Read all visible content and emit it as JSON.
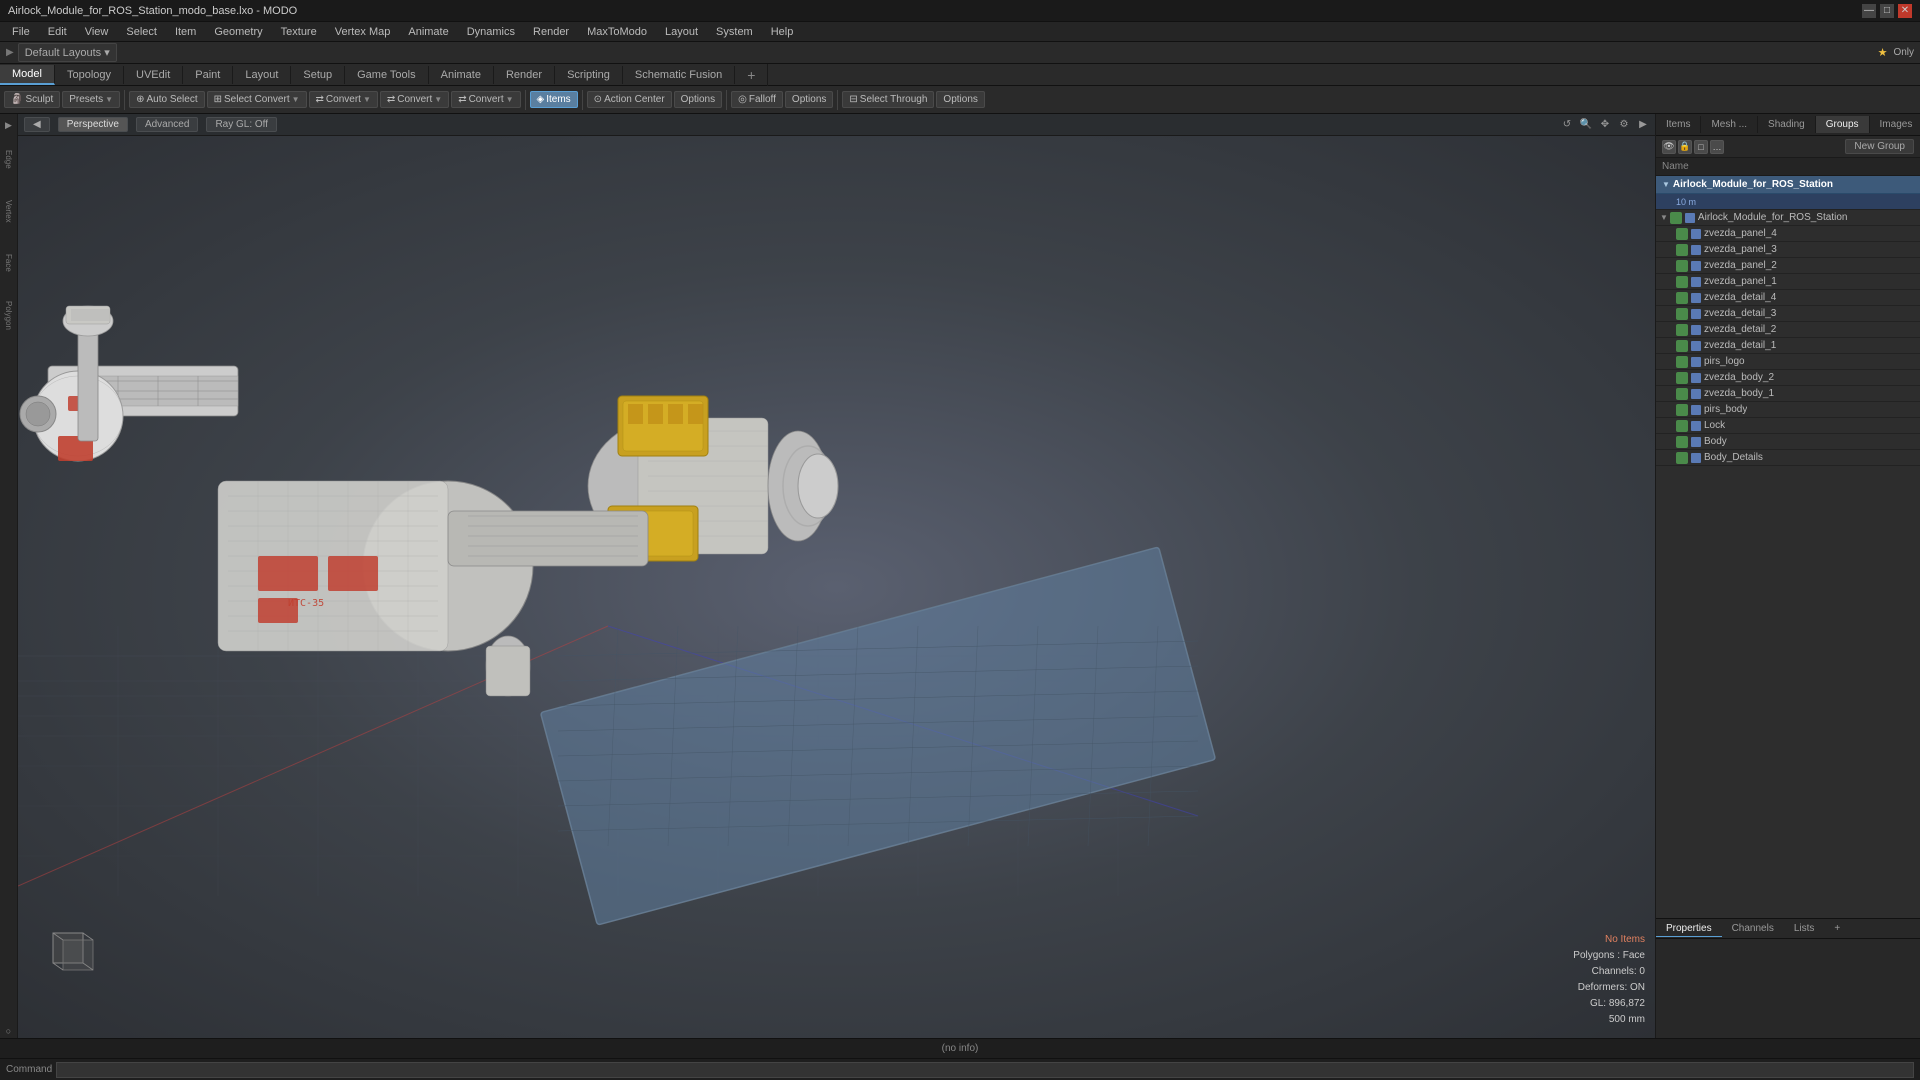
{
  "titleBar": {
    "title": "Airlock_Module_for_ROS_Station_modo_base.lxo - MODO",
    "winBtns": [
      "—",
      "□",
      "✕"
    ]
  },
  "menuBar": {
    "items": [
      "File",
      "Edit",
      "View",
      "Select",
      "Item",
      "Geometry",
      "Texture",
      "Vertex Map",
      "Animate",
      "Dynamics",
      "Render",
      "MaxToModo",
      "Layout",
      "System",
      "Help"
    ]
  },
  "layoutBar": {
    "layoutLabel": "Default Layouts",
    "rightIcons": [
      "★",
      "Only"
    ]
  },
  "modeTabs": {
    "tabs": [
      "Model",
      "Topology",
      "UVEdit",
      "Paint",
      "Layout",
      "Setup",
      "Game Tools",
      "Animate",
      "Render",
      "Scripting",
      "Schematic Fusion"
    ],
    "active": "Model",
    "addBtn": "+"
  },
  "toolbar": {
    "sculpt": "Sculpt",
    "presets": "Presets",
    "autoSelect": "Auto Select",
    "converts": [
      "Convert",
      "Convert",
      "Convert",
      "Convert"
    ],
    "items": "Items",
    "actionCenter": "Action Center",
    "options1": "Options",
    "falloff": "Falloff",
    "options2": "Options",
    "selectThrough": "Select Through",
    "options3": "Options"
  },
  "viewport": {
    "view": "Perspective",
    "mode": "Advanced",
    "raygl": "Ray GL: Off",
    "viewControls": [
      "↺",
      "🔍",
      "👁",
      "⚙",
      "▶"
    ]
  },
  "rightPanel": {
    "tabs": [
      "Items",
      "Mesh ...",
      "Shading",
      "Groups",
      "Images"
    ],
    "activeTab": "Groups",
    "addBtn": "+",
    "starOnly": "★ Only",
    "newGroup": "New Group",
    "nameHeader": "Name",
    "groupName": "Airlock_Module_for_ROS_Station",
    "groupLabel": "10 m",
    "items": [
      {
        "name": "Airlock_Module_for_ROS_Station",
        "level": 0,
        "type": "group",
        "expanded": true
      },
      {
        "name": "zvezda_panel_4",
        "level": 1,
        "type": "mesh"
      },
      {
        "name": "zvezda_panel_3",
        "level": 1,
        "type": "mesh"
      },
      {
        "name": "zvezda_panel_2",
        "level": 1,
        "type": "mesh"
      },
      {
        "name": "zvezda_panel_1",
        "level": 1,
        "type": "mesh"
      },
      {
        "name": "zvezda_detail_4",
        "level": 1,
        "type": "mesh"
      },
      {
        "name": "zvezda_detail_3",
        "level": 1,
        "type": "mesh"
      },
      {
        "name": "zvezda_detail_2",
        "level": 1,
        "type": "mesh"
      },
      {
        "name": "zvezda_detail_1",
        "level": 1,
        "type": "mesh"
      },
      {
        "name": "pirs_logo",
        "level": 1,
        "type": "mesh"
      },
      {
        "name": "zvezda_body_2",
        "level": 1,
        "type": "mesh"
      },
      {
        "name": "zvezda_body_1",
        "level": 1,
        "type": "mesh"
      },
      {
        "name": "pirs_body",
        "level": 1,
        "type": "mesh"
      },
      {
        "name": "Lock",
        "level": 1,
        "type": "mesh"
      },
      {
        "name": "Body",
        "level": 1,
        "type": "mesh"
      },
      {
        "name": "Body_Details",
        "level": 1,
        "type": "mesh"
      }
    ]
  },
  "propsPanel": {
    "tabs": [
      "Properties",
      "Channels",
      "Lists"
    ],
    "activeTab": "Properties",
    "addBtn": "+"
  },
  "stats": {
    "noItems": "No Items",
    "polygons": "Polygons : Face",
    "channels": "Channels: 0",
    "deformers": "Deformers: ON",
    "gl": "GL: 896,872",
    "units": "500 mm"
  },
  "statusBar": {
    "text": "(no info)"
  },
  "commandBar": {
    "label": "Command",
    "placeholder": ""
  },
  "leftSidebar": {
    "items": [
      "▶",
      "E",
      "V",
      "F",
      "P",
      "○"
    ]
  }
}
